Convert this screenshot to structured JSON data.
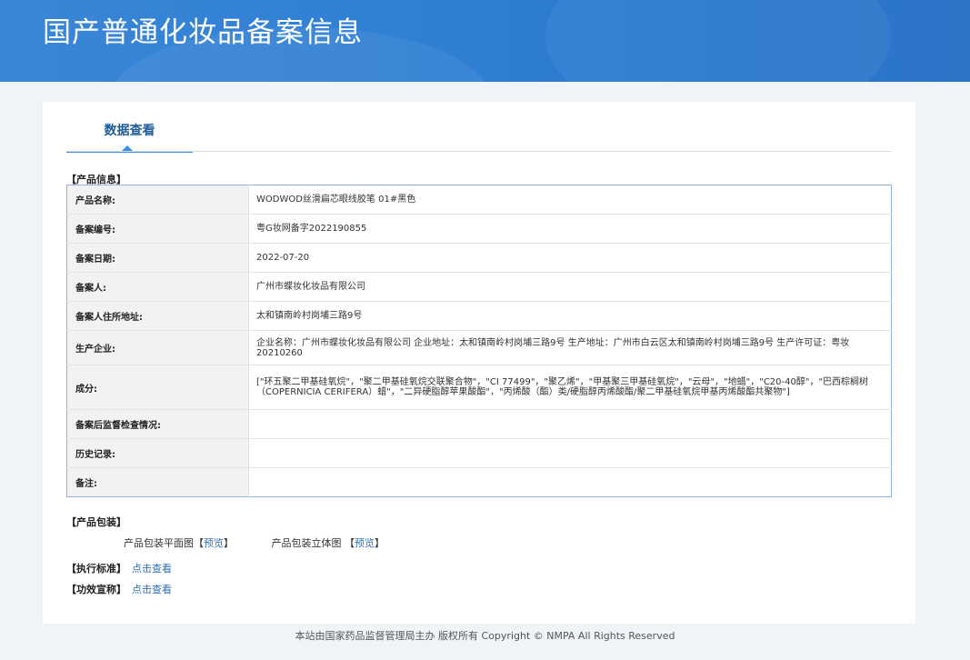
{
  "header": {
    "title": "国产普通化妆品备案信息"
  },
  "tab": {
    "label": "数据查看"
  },
  "product_info": {
    "section_label": "【产品信息】",
    "rows": [
      {
        "key": "产品名称:",
        "value": "WODWOD丝滑扁芯眼线胶笔 01#黑色"
      },
      {
        "key": "备案编号:",
        "value": "粤G妆网备字2022190855"
      },
      {
        "key": "备案日期:",
        "value": "2022-07-20"
      },
      {
        "key": "备案人:",
        "value": "广州市蝶妆化妆品有限公司"
      },
      {
        "key": "备案人住所地址:",
        "value": "太和镇南岭村岗埔三路9号"
      },
      {
        "key": "生产企业:",
        "value": "企业名称：广州市蝶妆化妆品有限公司 企业地址：太和镇南岭村岗埔三路9号 生产地址：广州市白云区太和镇南岭村岗埔三路9号 生产许可证：粤妆20210260"
      },
      {
        "key": "成分:",
        "value": "[\"环五聚二甲基硅氧烷\"，\"聚二甲基硅氧烷交联聚合物\"，\"CI 77499\"，\"聚乙烯\"，\"甲基聚三甲基硅氧烷\"，\"云母\"，\"地蜡\"，\"C20-40醇\"，\"巴西棕榈树（COPERNICIA CERIFERA）蜡\"，\"二异硬脂醇苹果酸酯\"，\"丙烯酸（酯）类/硬脂醇丙烯酸酯/聚二甲基硅氧烷甲基丙烯酸酯共聚物\"]"
      },
      {
        "key": "备案后监督检查情况:",
        "value": ""
      },
      {
        "key": "历史记录:",
        "value": ""
      },
      {
        "key": "备注:",
        "value": ""
      }
    ]
  },
  "packaging": {
    "section_label": "【产品包装】",
    "plan_label": "产品包装平面图",
    "solid_label": "产品包装立体图",
    "preview_open": "【",
    "preview_link": "预览",
    "preview_close": "】",
    "solid_open": "【",
    "solid_close": "】"
  },
  "standard": {
    "label": "【执行标准】",
    "link": "点击查看"
  },
  "efficacy": {
    "label": "【功效宣称】",
    "link": "点击查看"
  },
  "footer": {
    "text": "本站由国家药品监督管理局主办 版权所有 Copyright © NMPA All Rights Reserved"
  }
}
